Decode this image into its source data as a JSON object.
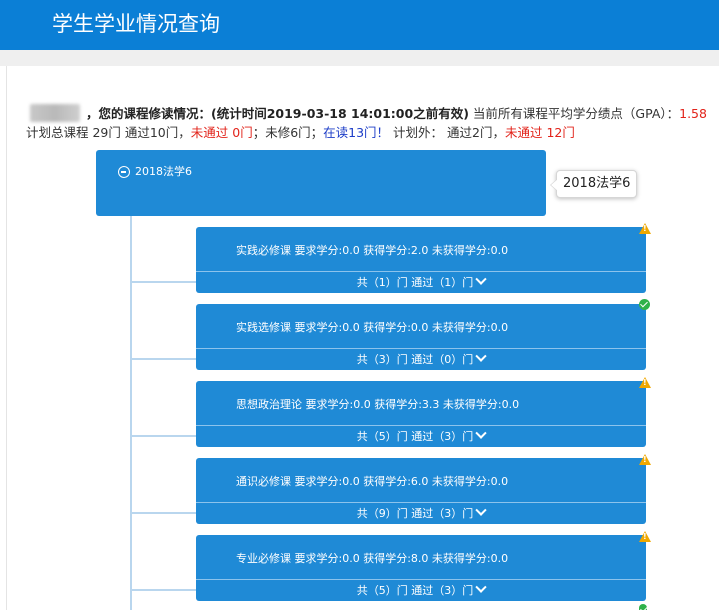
{
  "header": {
    "title": "学生学业情况查询"
  },
  "summary": {
    "intro": "，您的课程修读情况：(统计时间2019-03-18 14:01:00之前有效)",
    "gpa_label": " 当前所有课程平均学分绩点（GPA）：",
    "gpa_value": "1.58",
    "plan_total": "计划总课程 29门 通过10门，",
    "not_passed": "未通过 0门",
    "not_taken": "；未修6门；",
    "in_progress": "在读13门！",
    "outside_plan": " 计划外： 通过2门，",
    "outside_not_passed": "未通过 12门"
  },
  "root": {
    "label": "2018法学6",
    "tooltip": "2018法学6"
  },
  "categories": [
    {
      "top": "实践必修课 要求学分:0.0 获得学分:2.0  未获得学分:0.0",
      "bottom": "共（1）门 通过（1）门",
      "status": "warning-icon"
    },
    {
      "top": "实践选修课 要求学分:0.0 获得学分:0.0  未获得学分:0.0",
      "bottom": "共（3）门 通过（0）门",
      "status": "check-icon"
    },
    {
      "top": "思想政治理论 要求学分:0.0 获得学分:3.3  未获得学分:0.0",
      "bottom": "共（5）门 通过（3）门",
      "status": "warning-icon"
    },
    {
      "top": "通识必修课 要求学分:0.0 获得学分:6.0  未获得学分:0.0",
      "bottom": "共（9）门 通过（3）门",
      "status": "warning-icon"
    },
    {
      "top": "专业必修课 要求学分:0.0 获得学分:8.0  未获得学分:0.0",
      "bottom": "共（5）门 通过（3）门",
      "status": "warning-icon"
    }
  ],
  "colors": {
    "header": "#0b7fd6",
    "node": "#1f8ad6",
    "red": "#e2231a",
    "blue": "#1b3cc7"
  }
}
